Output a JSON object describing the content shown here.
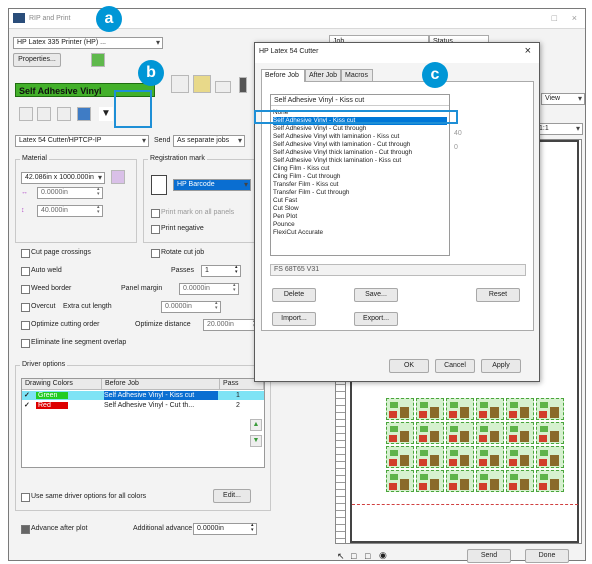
{
  "app": {
    "title": "RIP and Print"
  },
  "badges": {
    "a": "a",
    "b": "b",
    "c": "c"
  },
  "left": {
    "printer_combo": "HP Latex 335 Printer (HP) ...",
    "properties_button": "Properties...",
    "material_bar": "Self Adhesive Vinyl",
    "cutter_combo": "Latex 54 Cutter/HPTCP-IP",
    "send_label": "Send",
    "send_combo": "As separate jobs",
    "material_group": "Material",
    "material_size": "42.086in x 1000.000in",
    "material_x": "0.0000in",
    "material_y": "40.000in",
    "registration_group": "Registration mark",
    "registration_type": "HP Barcode",
    "reg_check1": "Print mark on all panels",
    "reg_check2": "Print negative",
    "cut_page_crossings": "Cut page crossings",
    "auto_weld": "Auto weld",
    "weed_border": "Weed border",
    "panel_margin_label": "Panel margin",
    "panel_margin": "0.0000in",
    "overcut": "Overcut",
    "extra_cut_length_label": "Extra cut length",
    "extra_cut_length": "0.0000in",
    "optimize_cutting_order": "Optimize cutting order",
    "optimize_distance_label": "Optimize distance",
    "optimize_distance": "20.000in",
    "eliminate_overlaps": "Eliminate line segment overlap",
    "rotate_cut_job": "Rotate cut job",
    "passes_label": "Passes",
    "passes": "1",
    "driver_options": "Driver options",
    "table_headers": [
      "Drawing Colors",
      "Before Job",
      "Pass"
    ],
    "table_rows": [
      {
        "color_name": "Green",
        "swatch": "#22cc22",
        "before_job": "Self Adhesive Vinyl - Kiss cut",
        "pass": "1"
      },
      {
        "color_name": "Red",
        "swatch": "#dd0000",
        "before_job": "Self Adhesive Vinyl - Cut th...",
        "pass": "2"
      }
    ],
    "use_same_driver": "Use same driver options for all colors",
    "edit_button": "Edit...",
    "advance_after_plot": "Advance after plot",
    "additional_advance_label": "Additional advance",
    "additional_advance": "0.0000in"
  },
  "right": {
    "col_job": "Job",
    "col_status": "Status",
    "view_combo": "View",
    "zoom_combo": "1:1",
    "send_button": "Send",
    "done_button": "Done"
  },
  "dialog": {
    "title": "HP Latex 54 Cutter",
    "tabs": [
      "Before Job",
      "After Job",
      "Macros"
    ],
    "selected": "Self Adhesive Vinyl - Kiss cut",
    "list_items": [
      "None",
      "Self Adhesive Vinyl - Kiss cut",
      "Self Adhesive Vinyl - Cut through",
      "Self Adhesive Vinyl with lamination - Kiss cut",
      "Self Adhesive Vinyl with lamination - Cut through",
      "Self Adhesive Vinyl thick lamination - Cut through",
      "Self Adhesive Vinyl thick lamination - Kiss cut",
      "Cling Film - Kiss cut",
      "Cling Film - Cut through",
      "Transfer Film - Kiss cut",
      "Transfer Film - Cut through",
      "Cut Fast",
      "Cut Slow",
      "Pen Plot",
      "Pounce",
      "FlexiCut Accurate"
    ],
    "highlighted_index": 1,
    "command_text": "FS 68T65 V31",
    "delete_button": "Delete",
    "save_button": "Save...",
    "reset_button": "Reset",
    "import_button": "Import...",
    "export_button": "Export...",
    "ok_button": "OK",
    "cancel_button": "Cancel",
    "apply_button": "Apply",
    "side_values": [
      "40",
      "0"
    ]
  }
}
